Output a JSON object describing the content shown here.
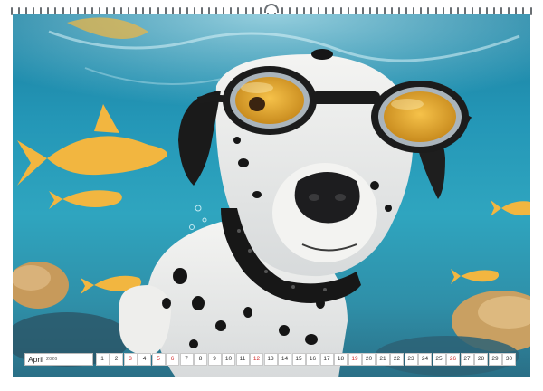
{
  "calendar": {
    "month": "April",
    "year": "2026",
    "days": [
      {
        "n": "1",
        "red": false
      },
      {
        "n": "2",
        "red": false
      },
      {
        "n": "3",
        "red": true
      },
      {
        "n": "4",
        "red": false
      },
      {
        "n": "5",
        "red": true
      },
      {
        "n": "6",
        "red": true
      },
      {
        "n": "7",
        "red": false
      },
      {
        "n": "8",
        "red": false
      },
      {
        "n": "9",
        "red": false
      },
      {
        "n": "10",
        "red": false
      },
      {
        "n": "11",
        "red": false
      },
      {
        "n": "12",
        "red": true
      },
      {
        "n": "13",
        "red": false
      },
      {
        "n": "14",
        "red": false
      },
      {
        "n": "15",
        "red": false
      },
      {
        "n": "16",
        "red": false
      },
      {
        "n": "17",
        "red": false
      },
      {
        "n": "18",
        "red": false
      },
      {
        "n": "19",
        "red": true
      },
      {
        "n": "20",
        "red": false
      },
      {
        "n": "21",
        "red": false
      },
      {
        "n": "22",
        "red": false
      },
      {
        "n": "23",
        "red": false
      },
      {
        "n": "24",
        "red": false
      },
      {
        "n": "25",
        "red": false
      },
      {
        "n": "26",
        "red": true
      },
      {
        "n": "27",
        "red": false
      },
      {
        "n": "28",
        "red": false
      },
      {
        "n": "29",
        "red": false
      },
      {
        "n": "30",
        "red": false
      }
    ],
    "holiday_color": "#d22c2c"
  },
  "photo": {
    "subject": "dalmatian-dog-with-swimming-goggles-underwater-icon",
    "colors": {
      "water": "#2497b7",
      "fish": "#f2b640",
      "goggle_lens": "#f0b030",
      "coral": "#d8b070"
    }
  }
}
